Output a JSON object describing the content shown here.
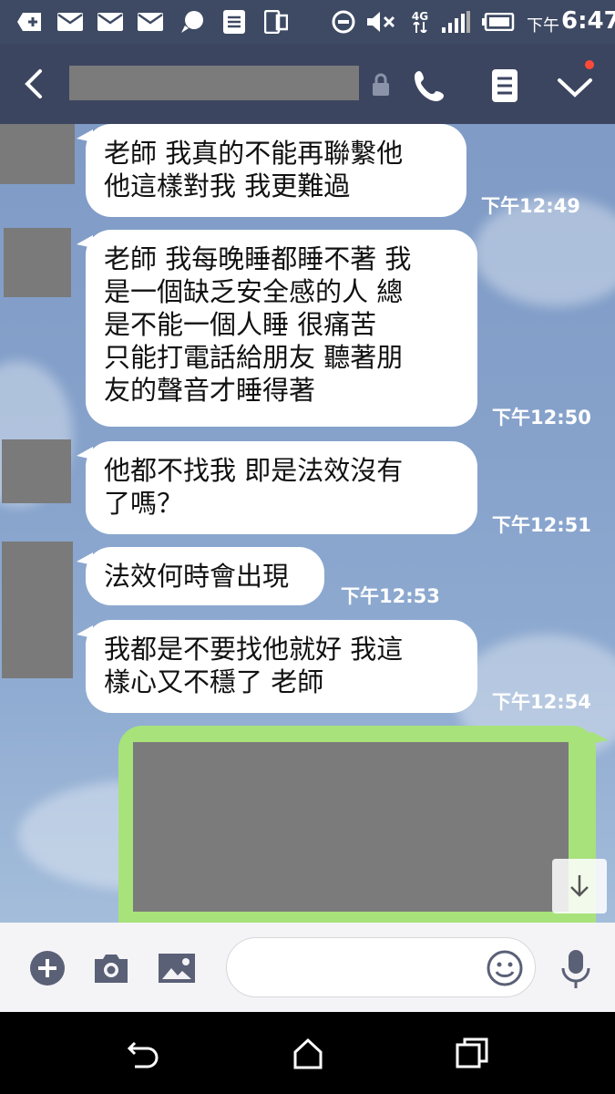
{
  "status_bar": {
    "time_prefix": "下午",
    "time": "6:47",
    "network": "4G",
    "icons": [
      "add-notification-icon",
      "mail-icon",
      "mail-icon",
      "mail-icon",
      "chat-icon",
      "document-icon",
      "phone-device-icon",
      "do-not-disturb-icon",
      "mute-icon",
      "network-4g-icon",
      "signal-icon",
      "battery-icon"
    ]
  },
  "header": {
    "icons": [
      "back-icon",
      "lock-icon",
      "phone-icon",
      "notes-icon",
      "chevron-down-icon"
    ]
  },
  "messages": [
    {
      "lines": [
        "老師 我真的不能再聯繫他",
        "他這樣對我 我更難過"
      ],
      "time": "下午12:49"
    },
    {
      "lines": [
        "老師 我每晚睡都睡不著 我",
        "是一個缺乏安全感的人 總",
        "是不能一個人睡 很痛苦",
        "只能打電話給朋友 聽著朋",
        "友的聲音才睡得著"
      ],
      "time": "下午12:50"
    },
    {
      "lines": [
        "他都不找我 即是法效沒有",
        "了嗎？"
      ],
      "time": "下午12:51"
    },
    {
      "lines": [
        "法效何時會出現"
      ],
      "time": "下午12:53"
    },
    {
      "lines": [
        "我都是不要找他就好 我這",
        "樣心又不穩了 老師"
      ],
      "time": "下午12:54"
    }
  ],
  "input_bar": {
    "icons": [
      "add-icon",
      "camera-icon",
      "image-icon",
      "emoji-icon",
      "microphone-icon"
    ],
    "placeholder": ""
  },
  "nav_bar": {
    "icons": [
      "back-nav-icon",
      "home-icon",
      "recents-icon"
    ]
  },
  "colors": {
    "header_bg": "#3c4560",
    "chat_bg": "#86a2cb",
    "outgoing_bubble": "#a8e27b",
    "incoming_bubble": "#ffffff",
    "notification_dot": "#ff4a3a"
  }
}
